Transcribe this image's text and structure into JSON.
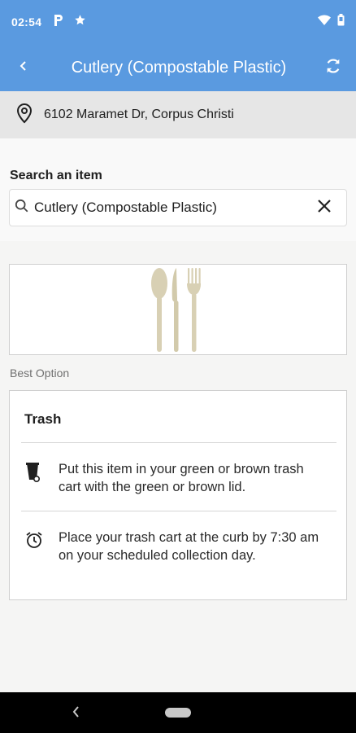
{
  "status_bar": {
    "time": "02:54",
    "left_icons": [
      "parking-icon",
      "star-icon"
    ],
    "right_icons": [
      "wifi-icon",
      "battery-icon"
    ]
  },
  "app_bar": {
    "title": "Cutlery (Compostable Plastic)",
    "back_icon": "chevron-left-icon",
    "refresh_icon": "refresh-icon"
  },
  "address": {
    "text": "6102 Maramet Dr, Corpus Christi",
    "icon": "location-pin-icon"
  },
  "search": {
    "label": "Search an item",
    "value": "Cutlery (Compostable Plastic)",
    "icon": "search-icon",
    "clear_icon": "close-icon"
  },
  "item_image": {
    "depicts": "cutlery-illustration"
  },
  "best_option_label": "Best Option",
  "result_card": {
    "title": "Trash",
    "rows": [
      {
        "icon": "trash-cart-icon",
        "text": "Put this item in your green or brown trash cart with the green or brown lid."
      },
      {
        "icon": "alarm-clock-icon",
        "text": "Place your trash cart at the curb by 7:30 am on your scheduled collection day."
      }
    ]
  },
  "colors": {
    "primary": "#5a9ae0",
    "address_bg": "#e6e6e6",
    "background": "#f5f5f4",
    "nav_bar": "#000000"
  }
}
